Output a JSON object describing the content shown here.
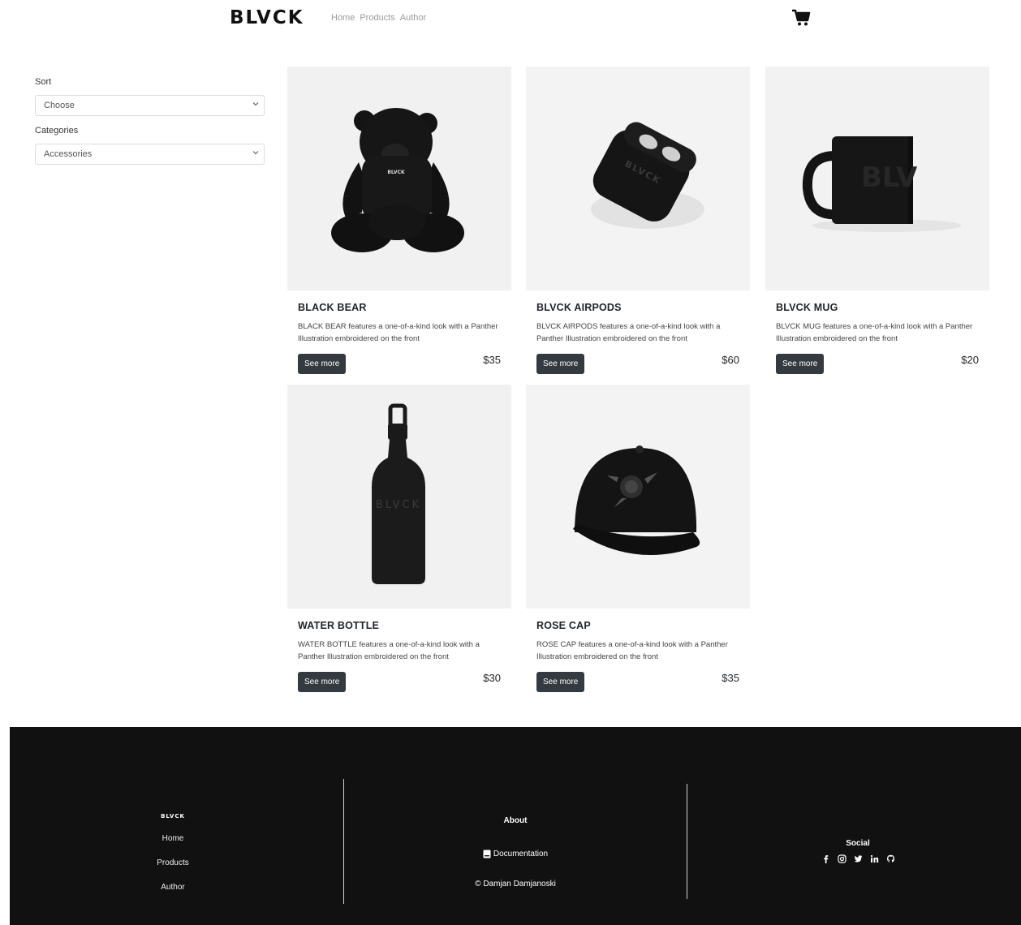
{
  "header": {
    "brand": "BLVCK",
    "nav": [
      "Home",
      "Products",
      "Author"
    ]
  },
  "sidebar": {
    "sort_label": "Sort",
    "sort_value": "Choose",
    "categories_label": "Categories",
    "categories_value": "Accessories"
  },
  "products": [
    {
      "title": "BLACK BEAR",
      "description": "BLACK BEAR features a one-of-a-kind look with a Panther Illustration embroidered on the front",
      "button": "See more",
      "price": "$35"
    },
    {
      "title": "BLVCK AIRPODS",
      "description": "BLVCK AIRPODS features a one-of-a-kind look with a Panther Illustration embroidered on the front",
      "button": "See more",
      "price": "$60"
    },
    {
      "title": "BLVCK MUG",
      "description": "BLVCK MUG features a one-of-a-kind look with a Panther Illustration embroidered on the front",
      "button": "See more",
      "price": "$20"
    },
    {
      "title": "WATER BOTTLE",
      "description": "WATER BOTTLE features a one-of-a-kind look with a Panther Illustration embroidered on the front",
      "button": "See more",
      "price": "$30"
    },
    {
      "title": "ROSE CAP",
      "description": "ROSE CAP features a one-of-a-kind look with a Panther Illustration embroidered on the front",
      "button": "See more",
      "price": "$35"
    }
  ],
  "footer": {
    "brand": "BLVCK",
    "links": [
      "Home",
      "Products",
      "Author"
    ],
    "about": "About",
    "documentation": "Documentation",
    "copyright": "© Damjan Damjanoski",
    "social": "Social",
    "social_icons": [
      "facebook-icon",
      "instagram-icon",
      "twitter-icon",
      "linkedin-icon",
      "github-icon"
    ]
  },
  "colors": {
    "footer_bg": "#111111",
    "button_bg": "#343a40",
    "image_bg": "#efefef"
  }
}
